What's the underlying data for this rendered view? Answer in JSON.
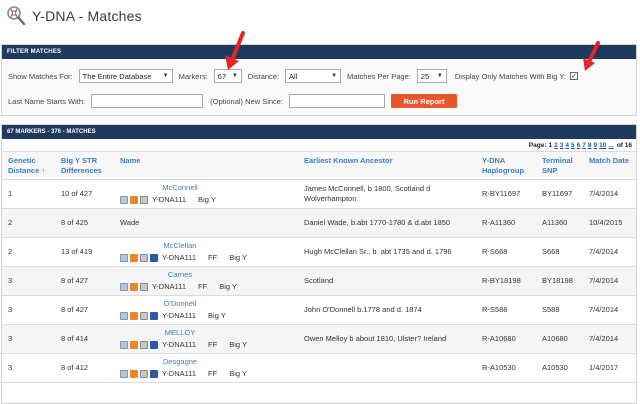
{
  "header": {
    "title": "Y-DNA - Matches"
  },
  "filter": {
    "bar_title": "FILTER MATCHES",
    "show_matches_label": "Show Matches For:",
    "show_matches_value": "The Entire Database",
    "markers_label": "Markers:",
    "markers_value": "67",
    "distance_label": "Distance:",
    "distance_value": "All",
    "per_page_label": "Matches Per Page:",
    "per_page_value": "25",
    "bigy_label": "Display Only Matches With Big Y:",
    "bigy_checked": "✓",
    "last_name_label": "Last Name Starts With:",
    "since_label": "(Optional) New Since:",
    "run_report": "Run Report"
  },
  "results": {
    "bar_title": "67 MARKERS - 376 - MATCHES",
    "pager": {
      "label": "Page:",
      "pages": [
        "1",
        "2",
        "3",
        "4",
        "5",
        "6",
        "7",
        "8",
        "9",
        "10",
        "..."
      ],
      "of_label": "of 16"
    },
    "columns": {
      "distance": "Genetic Distance ↑",
      "bigy_str": "Big Y STR Differences",
      "name": "Name",
      "ancestor": "Earliest Known Ancestor",
      "haplogroup": "Y-DNA Haplogroup",
      "snp": "Terminal SNP",
      "date": "Match Date"
    },
    "rows": [
      {
        "distance": "1",
        "bigy_str": "10 of 427",
        "name": "McConnell",
        "name_link": true,
        "ydna": "Y-DNA111",
        "ff": "",
        "bigy": "Big Y",
        "has_ff": false,
        "ancestor": "James McConnell, b 1800, Scotland d Wolverhampton",
        "haplogroup": "R-BY11697",
        "snp": "BY11697",
        "date": "7/4/2014"
      },
      {
        "distance": "2",
        "bigy_str": "8 of 425",
        "name": "Wade",
        "name_link": false,
        "ydna": "",
        "ff": "",
        "bigy": "",
        "has_ff": false,
        "ancestor": "Daniel Wade, b.abt 1770-1780 & d.abt 1850",
        "haplogroup": "R-A11360",
        "snp": "A11360",
        "date": "10/4/2015"
      },
      {
        "distance": "2",
        "bigy_str": "13 of 419",
        "name": "McClellan",
        "name_link": true,
        "ydna": "Y-DNA111",
        "ff": "FF",
        "bigy": "Big Y",
        "has_ff": true,
        "ancestor": "Hugh McClellan Sr., b. abt 1735 and d. 1796",
        "haplogroup": "R-S668",
        "snp": "S668",
        "date": "7/4/2014"
      },
      {
        "distance": "3",
        "bigy_str": "8 of 427",
        "name": "Carnes",
        "name_link": true,
        "ydna": "Y-DNA111",
        "ff": "FF",
        "bigy": "Big Y",
        "has_ff": false,
        "ancestor": "Scotland",
        "haplogroup": "R-BY18198",
        "snp": "BY18198",
        "date": "7/4/2014"
      },
      {
        "distance": "3",
        "bigy_str": "8 of 427",
        "name": "O'Donnell",
        "name_link": true,
        "ydna": "Y-DNA111",
        "ff": "",
        "bigy": "Big Y",
        "has_ff": true,
        "ancestor": "John O'Donnell b.1778 and d. 1874",
        "haplogroup": "R-S588",
        "snp": "S588",
        "date": "7/4/2014"
      },
      {
        "distance": "3",
        "bigy_str": "8 of 414",
        "name": "MELLOY",
        "name_link": true,
        "ydna": "Y-DNA111",
        "ff": "FF",
        "bigy": "Big Y",
        "has_ff": true,
        "ancestor": "Owen Melloy b about 1810, Ulster? Ireland",
        "haplogroup": "R-A10680",
        "snp": "A10680",
        "date": "7/4/2014"
      },
      {
        "distance": "3",
        "bigy_str": "8 of 412",
        "name": "Desgagne",
        "name_link": true,
        "ydna": "Y-DNA111",
        "ff": "FF",
        "bigy": "Big Y",
        "has_ff": true,
        "ancestor": "",
        "haplogroup": "R-A10530",
        "snp": "A10530",
        "date": "1/4/2017"
      }
    ]
  },
  "colors": {
    "header_bar": "#1f3a5f",
    "link": "#3d7ec0",
    "button": "#e8562a",
    "annotation_arrow": "#e0262a"
  }
}
